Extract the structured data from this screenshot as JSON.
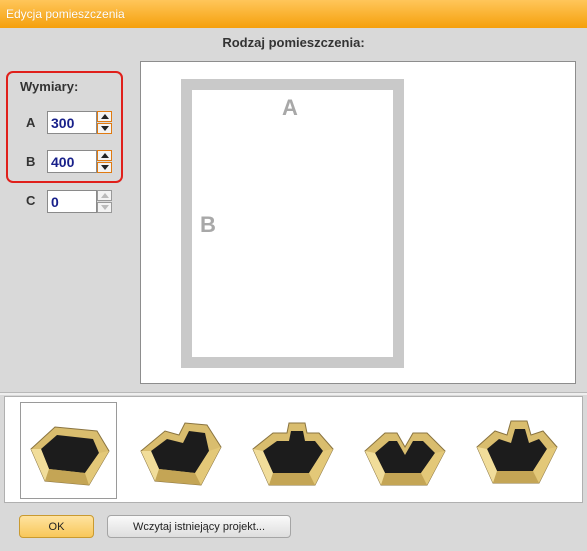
{
  "window": {
    "title": "Edycja pomieszczenia"
  },
  "room_type_label": "Rodzaj pomieszczenia:",
  "dimensions": {
    "title": "Wymiary:",
    "fields": [
      {
        "label": "A",
        "value": "300"
      },
      {
        "label": "B",
        "value": "400"
      },
      {
        "label": "C",
        "value": "0"
      }
    ]
  },
  "preview": {
    "label_a": "A",
    "label_b": "B"
  },
  "room_shapes": [
    {
      "name": "room-shape-1",
      "selected": true
    },
    {
      "name": "room-shape-2",
      "selected": false
    },
    {
      "name": "room-shape-3",
      "selected": false
    },
    {
      "name": "room-shape-4",
      "selected": false
    },
    {
      "name": "room-shape-5",
      "selected": false
    }
  ],
  "buttons": {
    "ok": "OK",
    "load_project": "Wczytaj istniejący projekt..."
  },
  "colors": {
    "titlebar": "#f5a00c",
    "highlight_border": "#e0201b",
    "input_text": "#18208a",
    "room_outline": "#c9c9c9",
    "wall_fill": "#e8cf88",
    "floor_fill": "#1c1c1c"
  }
}
